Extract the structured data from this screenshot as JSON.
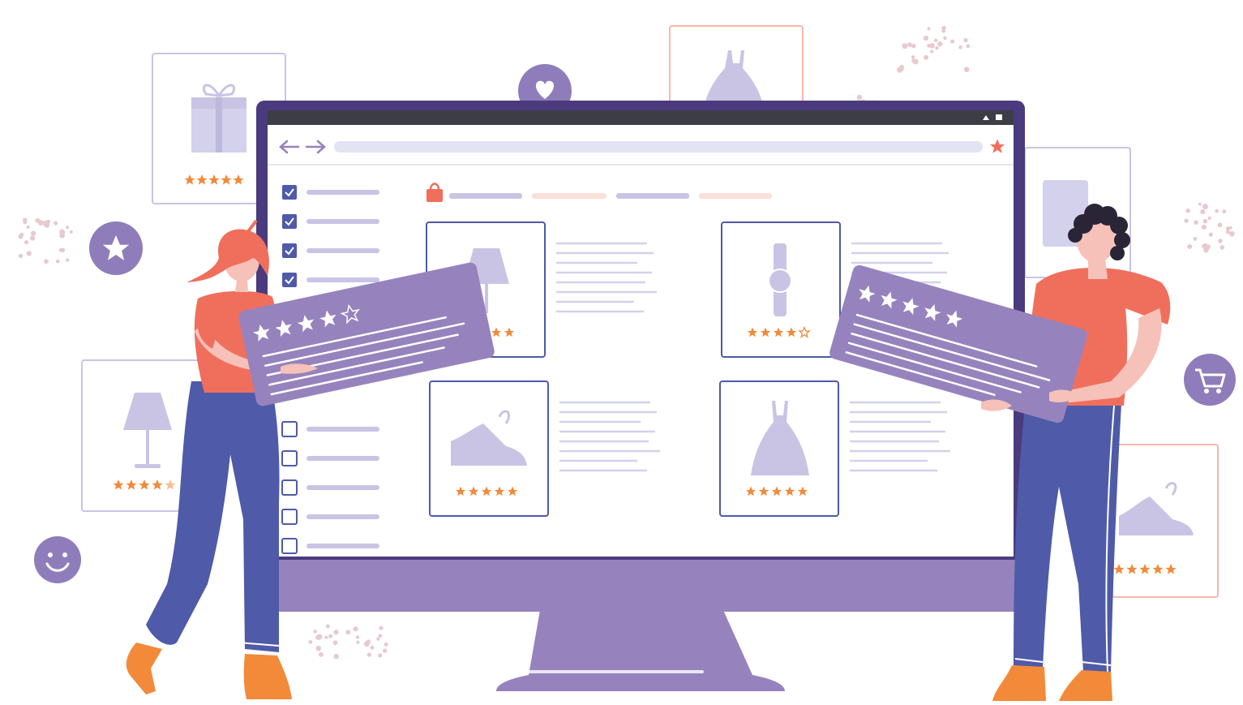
{
  "palette": {
    "purple_dark": "#4a3a7e",
    "purple": "#9683bd",
    "purple_light": "#c9c4e4",
    "lavender": "#d3d1ec",
    "bar_gray": "#3d3d45",
    "orange": "#f28a3a",
    "coral": "#f06f5c",
    "coral_light": "#f7b7a9",
    "blue_jeans": "#4f5aa8",
    "skin": "#f6c1b8",
    "hair_dark": "#2a2536"
  },
  "browser": {
    "nav_back_icon": "arrow-left-icon",
    "nav_forward_icon": "arrow-right-icon",
    "bookmark_icon": "star-icon"
  },
  "filters": [
    {
      "checked": true
    },
    {
      "checked": true
    },
    {
      "checked": true
    },
    {
      "checked": true
    },
    {
      "checked": false
    },
    {
      "checked": false
    },
    {
      "checked": false
    },
    {
      "checked": false
    },
    {
      "checked": false
    }
  ],
  "products": [
    {
      "item": "lamp",
      "rating": 5
    },
    {
      "item": "watch",
      "rating": 4
    },
    {
      "item": "sneaker",
      "rating": 5
    },
    {
      "item": "dress",
      "rating": 5
    }
  ],
  "review_cards": [
    {
      "owner": "woman",
      "rating": 4
    },
    {
      "owner": "man",
      "rating": 5
    }
  ],
  "floating_cards": [
    {
      "item": "gift",
      "rating": 5
    },
    {
      "item": "dress",
      "rating": 0
    },
    {
      "item": "lamp",
      "rating": 4.5
    },
    {
      "item": "tablet",
      "rating": 0
    },
    {
      "item": "sneaker",
      "rating": 5
    }
  ],
  "badges": [
    "star-badge-icon",
    "heart-badge-icon",
    "smiley-icon",
    "cart-badge-icon"
  ]
}
